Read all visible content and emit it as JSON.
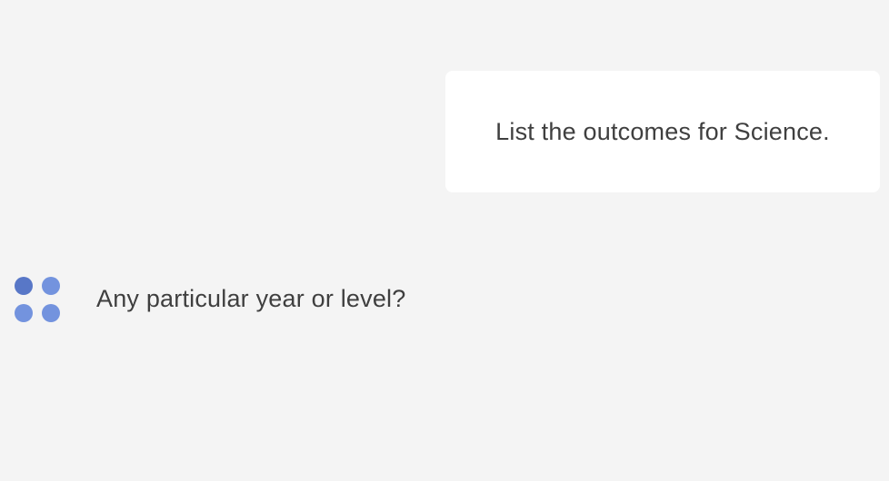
{
  "messages": {
    "user": {
      "text": "List the outcomes for Science."
    },
    "assistant": {
      "text": "Any particular year or level?",
      "avatar_icon": "four-dot-logo-icon"
    }
  },
  "colors": {
    "background": "#f4f4f4",
    "user_bubble": "#ffffff",
    "text": "#3f3f3f",
    "avatar_dot": "#7393de",
    "avatar_dot_active": "#5877c7"
  }
}
